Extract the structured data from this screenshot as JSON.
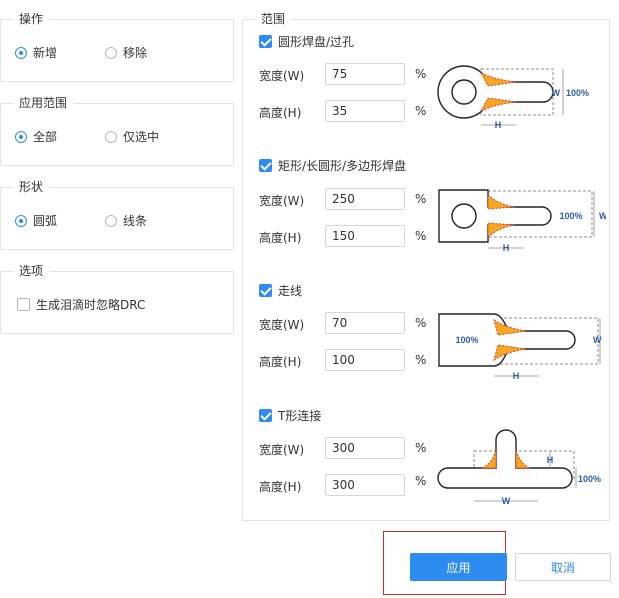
{
  "operation": {
    "title": "操作",
    "options": [
      "新增",
      "移除"
    ],
    "selected": 0
  },
  "scope": {
    "title": "应用范围",
    "options": [
      "全部",
      "仅选中"
    ],
    "selected": 0
  },
  "shape": {
    "title": "形状",
    "options": [
      "圆弧",
      "线条"
    ],
    "selected": 0
  },
  "options": {
    "title": "选项",
    "ignore_drc": {
      "label": "生成泪滴时忽略DRC",
      "checked": false
    }
  },
  "range": {
    "title": "范围",
    "width_label": "宽度(W)",
    "height_label": "高度(H)",
    "unit": "%",
    "sections": [
      {
        "label": "圆形焊盘/过孔",
        "checked": true,
        "width": "75",
        "height": "35"
      },
      {
        "label": "矩形/长圆形/多边形焊盘",
        "checked": true,
        "width": "250",
        "height": "150"
      },
      {
        "label": "走线",
        "checked": true,
        "width": "70",
        "height": "100"
      },
      {
        "label": "T形连接",
        "checked": true,
        "width": "300",
        "height": "300"
      }
    ],
    "diagram_text": {
      "w": "W",
      "h": "H",
      "pct": "100%"
    }
  },
  "buttons": {
    "apply": "应用",
    "cancel": "取消"
  },
  "colors": {
    "accent": "#2d8cf0",
    "highlight": "#d9262b",
    "teardrop_fill": "#f5a623",
    "teardrop_edge": "#e03c28"
  }
}
